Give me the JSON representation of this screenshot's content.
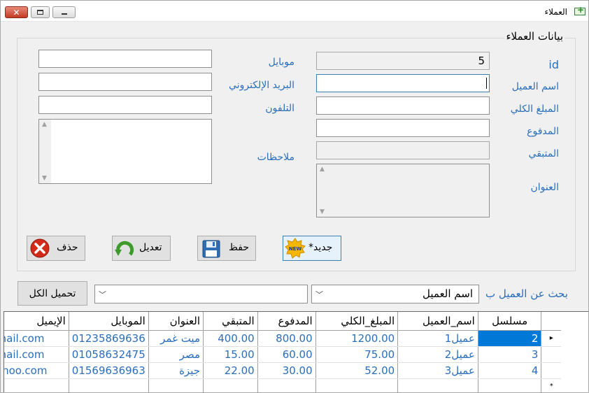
{
  "window": {
    "title": "العملاء",
    "close_glyph": "✕"
  },
  "group": {
    "title": "بيانات العملاء"
  },
  "form": {
    "id_label": "id",
    "id_value": "5",
    "name_label": "اسم العميل",
    "total_label": "المبلغ الكلي",
    "paid_label": "المدفوع",
    "remaining_label": "المتبقي",
    "address_label": "العنوان",
    "mobile_label": "موبايل",
    "email_label": "البريد الإلكتروني",
    "phone_label": "التلفون",
    "notes_label": "ملاحظات"
  },
  "buttons": {
    "new": "*جديد",
    "new_badge": "NEW",
    "save": "حفظ",
    "edit": "تعديل",
    "delete": "حذف",
    "load_all": "تحميل  الكل"
  },
  "search": {
    "label": "بحث عن العميل ب",
    "field_value": "اسم العميل",
    "query_value": ""
  },
  "grid": {
    "columns": [
      "مسلسل",
      "اسم_العميل",
      "المبلغ_الكلي",
      "المدفوع",
      "المتبقي",
      "العنوان",
      "الموبايل",
      "الإيميل"
    ],
    "rows": [
      [
        "2",
        "عميل1",
        "1200.00",
        "800.00",
        "400.00",
        "ميت غمر",
        "01235869636",
        "@gmail.com"
      ],
      [
        "3",
        "عميل2",
        "75.00",
        "60.00",
        "15.00",
        "مصر",
        "01058632475",
        "@gmail.com"
      ],
      [
        "4",
        "عميل3",
        "52.00",
        "30.00",
        "22.00",
        "جيزة",
        "01569636963",
        "@yahoo.com"
      ]
    ],
    "current_row_marker": "▸",
    "new_row_marker": "*"
  },
  "colors": {
    "accent": "#2a6ebb",
    "selection": "#0078d7"
  }
}
